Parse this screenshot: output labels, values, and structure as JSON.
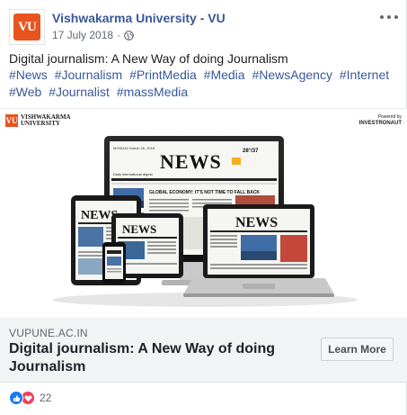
{
  "post": {
    "page_name": "Vishwakarma University - VU",
    "date": "17 July 2018",
    "dot": "·",
    "text": "Digital journalism: A New Way of doing Journalism",
    "hashtags": [
      "#News",
      "#Journalism",
      "#PrintMedia",
      "#Media",
      "#NewsAgency",
      "#Internet",
      "#Web",
      "#Journalist",
      "#massMedia"
    ],
    "avatar_letters": "VU"
  },
  "link": {
    "image": {
      "logo_mark": "VU",
      "logo_text_1": "VISHWAKARMA",
      "logo_text_2": "UNIVERSITY",
      "partner_small": "Powered by",
      "partner_name": "INVESTRONAUT",
      "newspaper_headline": "NEWS",
      "monitor_dateline": "MONDAY March 26, 2018",
      "monitor_weather": "28°/37",
      "monitor_subhead": "Daily international digest",
      "monitor_ticker": "GLOBAL ECONOMY: IT'S NOT TIME TO FALL BACK"
    },
    "domain": "VUPUNE.AC.IN",
    "title": "Digital journalism: A New Way of doing Journalism",
    "cta_label": "Learn More"
  },
  "reactions": {
    "count": "22",
    "icons": [
      "like-icon",
      "love-icon"
    ]
  },
  "colors": {
    "brand_orange": "#e8541e",
    "link_blue": "#385898",
    "like_blue": "#1877f2",
    "love_red": "#f33e58"
  }
}
